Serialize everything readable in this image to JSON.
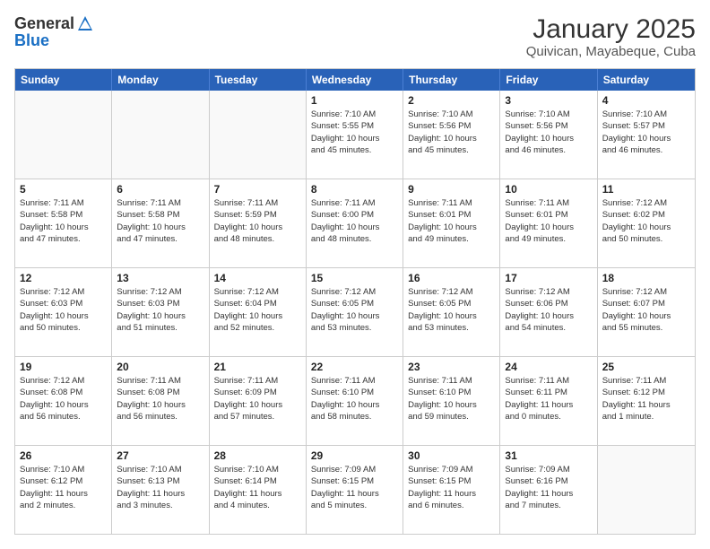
{
  "header": {
    "logo_general": "General",
    "logo_blue": "Blue",
    "month_year": "January 2025",
    "location": "Quivican, Mayabeque, Cuba"
  },
  "weekdays": [
    "Sunday",
    "Monday",
    "Tuesday",
    "Wednesday",
    "Thursday",
    "Friday",
    "Saturday"
  ],
  "rows": [
    [
      {
        "day": "",
        "info": ""
      },
      {
        "day": "",
        "info": ""
      },
      {
        "day": "",
        "info": ""
      },
      {
        "day": "1",
        "info": "Sunrise: 7:10 AM\nSunset: 5:55 PM\nDaylight: 10 hours\nand 45 minutes."
      },
      {
        "day": "2",
        "info": "Sunrise: 7:10 AM\nSunset: 5:56 PM\nDaylight: 10 hours\nand 45 minutes."
      },
      {
        "day": "3",
        "info": "Sunrise: 7:10 AM\nSunset: 5:56 PM\nDaylight: 10 hours\nand 46 minutes."
      },
      {
        "day": "4",
        "info": "Sunrise: 7:10 AM\nSunset: 5:57 PM\nDaylight: 10 hours\nand 46 minutes."
      }
    ],
    [
      {
        "day": "5",
        "info": "Sunrise: 7:11 AM\nSunset: 5:58 PM\nDaylight: 10 hours\nand 47 minutes."
      },
      {
        "day": "6",
        "info": "Sunrise: 7:11 AM\nSunset: 5:58 PM\nDaylight: 10 hours\nand 47 minutes."
      },
      {
        "day": "7",
        "info": "Sunrise: 7:11 AM\nSunset: 5:59 PM\nDaylight: 10 hours\nand 48 minutes."
      },
      {
        "day": "8",
        "info": "Sunrise: 7:11 AM\nSunset: 6:00 PM\nDaylight: 10 hours\nand 48 minutes."
      },
      {
        "day": "9",
        "info": "Sunrise: 7:11 AM\nSunset: 6:01 PM\nDaylight: 10 hours\nand 49 minutes."
      },
      {
        "day": "10",
        "info": "Sunrise: 7:11 AM\nSunset: 6:01 PM\nDaylight: 10 hours\nand 49 minutes."
      },
      {
        "day": "11",
        "info": "Sunrise: 7:12 AM\nSunset: 6:02 PM\nDaylight: 10 hours\nand 50 minutes."
      }
    ],
    [
      {
        "day": "12",
        "info": "Sunrise: 7:12 AM\nSunset: 6:03 PM\nDaylight: 10 hours\nand 50 minutes."
      },
      {
        "day": "13",
        "info": "Sunrise: 7:12 AM\nSunset: 6:03 PM\nDaylight: 10 hours\nand 51 minutes."
      },
      {
        "day": "14",
        "info": "Sunrise: 7:12 AM\nSunset: 6:04 PM\nDaylight: 10 hours\nand 52 minutes."
      },
      {
        "day": "15",
        "info": "Sunrise: 7:12 AM\nSunset: 6:05 PM\nDaylight: 10 hours\nand 53 minutes."
      },
      {
        "day": "16",
        "info": "Sunrise: 7:12 AM\nSunset: 6:05 PM\nDaylight: 10 hours\nand 53 minutes."
      },
      {
        "day": "17",
        "info": "Sunrise: 7:12 AM\nSunset: 6:06 PM\nDaylight: 10 hours\nand 54 minutes."
      },
      {
        "day": "18",
        "info": "Sunrise: 7:12 AM\nSunset: 6:07 PM\nDaylight: 10 hours\nand 55 minutes."
      }
    ],
    [
      {
        "day": "19",
        "info": "Sunrise: 7:12 AM\nSunset: 6:08 PM\nDaylight: 10 hours\nand 56 minutes."
      },
      {
        "day": "20",
        "info": "Sunrise: 7:11 AM\nSunset: 6:08 PM\nDaylight: 10 hours\nand 56 minutes."
      },
      {
        "day": "21",
        "info": "Sunrise: 7:11 AM\nSunset: 6:09 PM\nDaylight: 10 hours\nand 57 minutes."
      },
      {
        "day": "22",
        "info": "Sunrise: 7:11 AM\nSunset: 6:10 PM\nDaylight: 10 hours\nand 58 minutes."
      },
      {
        "day": "23",
        "info": "Sunrise: 7:11 AM\nSunset: 6:10 PM\nDaylight: 10 hours\nand 59 minutes."
      },
      {
        "day": "24",
        "info": "Sunrise: 7:11 AM\nSunset: 6:11 PM\nDaylight: 11 hours\nand 0 minutes."
      },
      {
        "day": "25",
        "info": "Sunrise: 7:11 AM\nSunset: 6:12 PM\nDaylight: 11 hours\nand 1 minute."
      }
    ],
    [
      {
        "day": "26",
        "info": "Sunrise: 7:10 AM\nSunset: 6:12 PM\nDaylight: 11 hours\nand 2 minutes."
      },
      {
        "day": "27",
        "info": "Sunrise: 7:10 AM\nSunset: 6:13 PM\nDaylight: 11 hours\nand 3 minutes."
      },
      {
        "day": "28",
        "info": "Sunrise: 7:10 AM\nSunset: 6:14 PM\nDaylight: 11 hours\nand 4 minutes."
      },
      {
        "day": "29",
        "info": "Sunrise: 7:09 AM\nSunset: 6:15 PM\nDaylight: 11 hours\nand 5 minutes."
      },
      {
        "day": "30",
        "info": "Sunrise: 7:09 AM\nSunset: 6:15 PM\nDaylight: 11 hours\nand 6 minutes."
      },
      {
        "day": "31",
        "info": "Sunrise: 7:09 AM\nSunset: 6:16 PM\nDaylight: 11 hours\nand 7 minutes."
      },
      {
        "day": "",
        "info": ""
      }
    ]
  ]
}
